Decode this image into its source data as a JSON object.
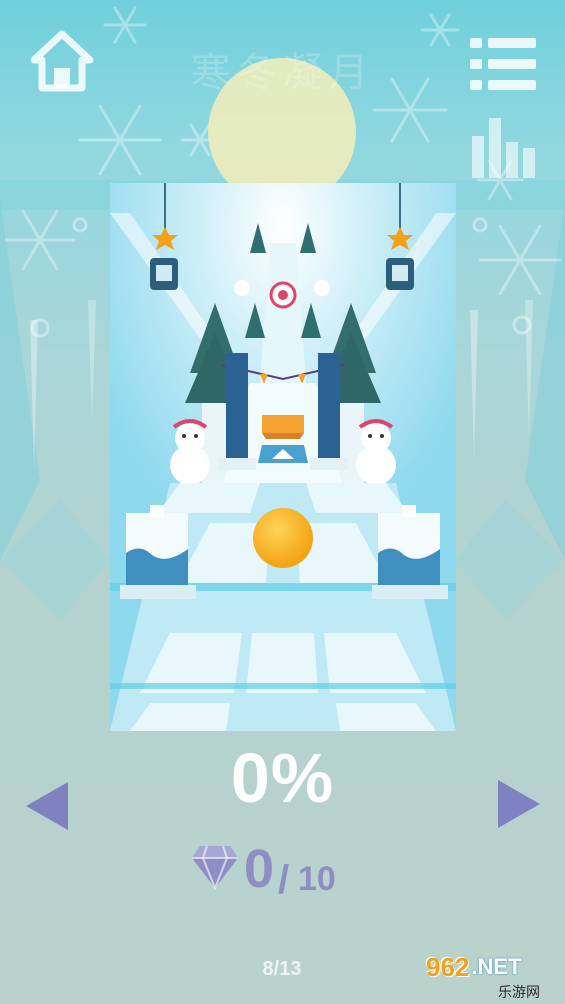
{
  "level": {
    "title": "寒冬凝月",
    "progress_text": "0%",
    "progress": 0,
    "gems_collected": "0",
    "gems_separator": "/",
    "gems_total": "10",
    "page_indicator": "8/13"
  },
  "icons": {
    "home": "home-icon",
    "menu": "menu-list-icon",
    "stats": "bar-chart-icon",
    "prev": "triangle-left-icon",
    "next": "triangle-right-icon",
    "gem": "diamond-icon"
  },
  "watermark": {
    "logo": "962",
    "domain": ".NET",
    "sub": "乐游网"
  },
  "colors": {
    "icon_white": "#ffffff",
    "arrow": "#7f82c0",
    "gem": "#8d8ec4",
    "ball": "#f6b323"
  }
}
